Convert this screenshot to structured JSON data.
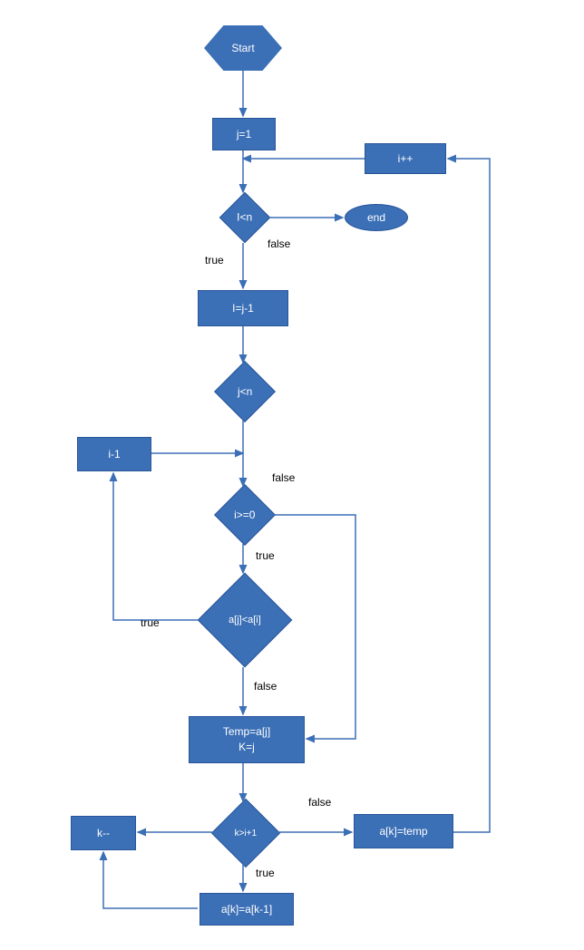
{
  "nodes": {
    "start": "Start",
    "init_j": "j=1",
    "inc_i": "i++",
    "cond_I_lt_n": "I<n",
    "end": "end",
    "set_I": "I=j-1",
    "cond_j_lt_n": "j<n",
    "i_minus_1": "i-1",
    "cond_i_ge_0": "i>=0",
    "cond_aj_lt_ai": "a[j]<a[i]",
    "temp_block": "Temp=a[j]\nK=j",
    "cond_k_gt_i1": "k>i+1",
    "k_dec": "k--",
    "ak_temp": "a[k]=temp",
    "ak_ak1": "a[k]=a[k-1]"
  },
  "labels": {
    "true": "true",
    "false": "false"
  }
}
